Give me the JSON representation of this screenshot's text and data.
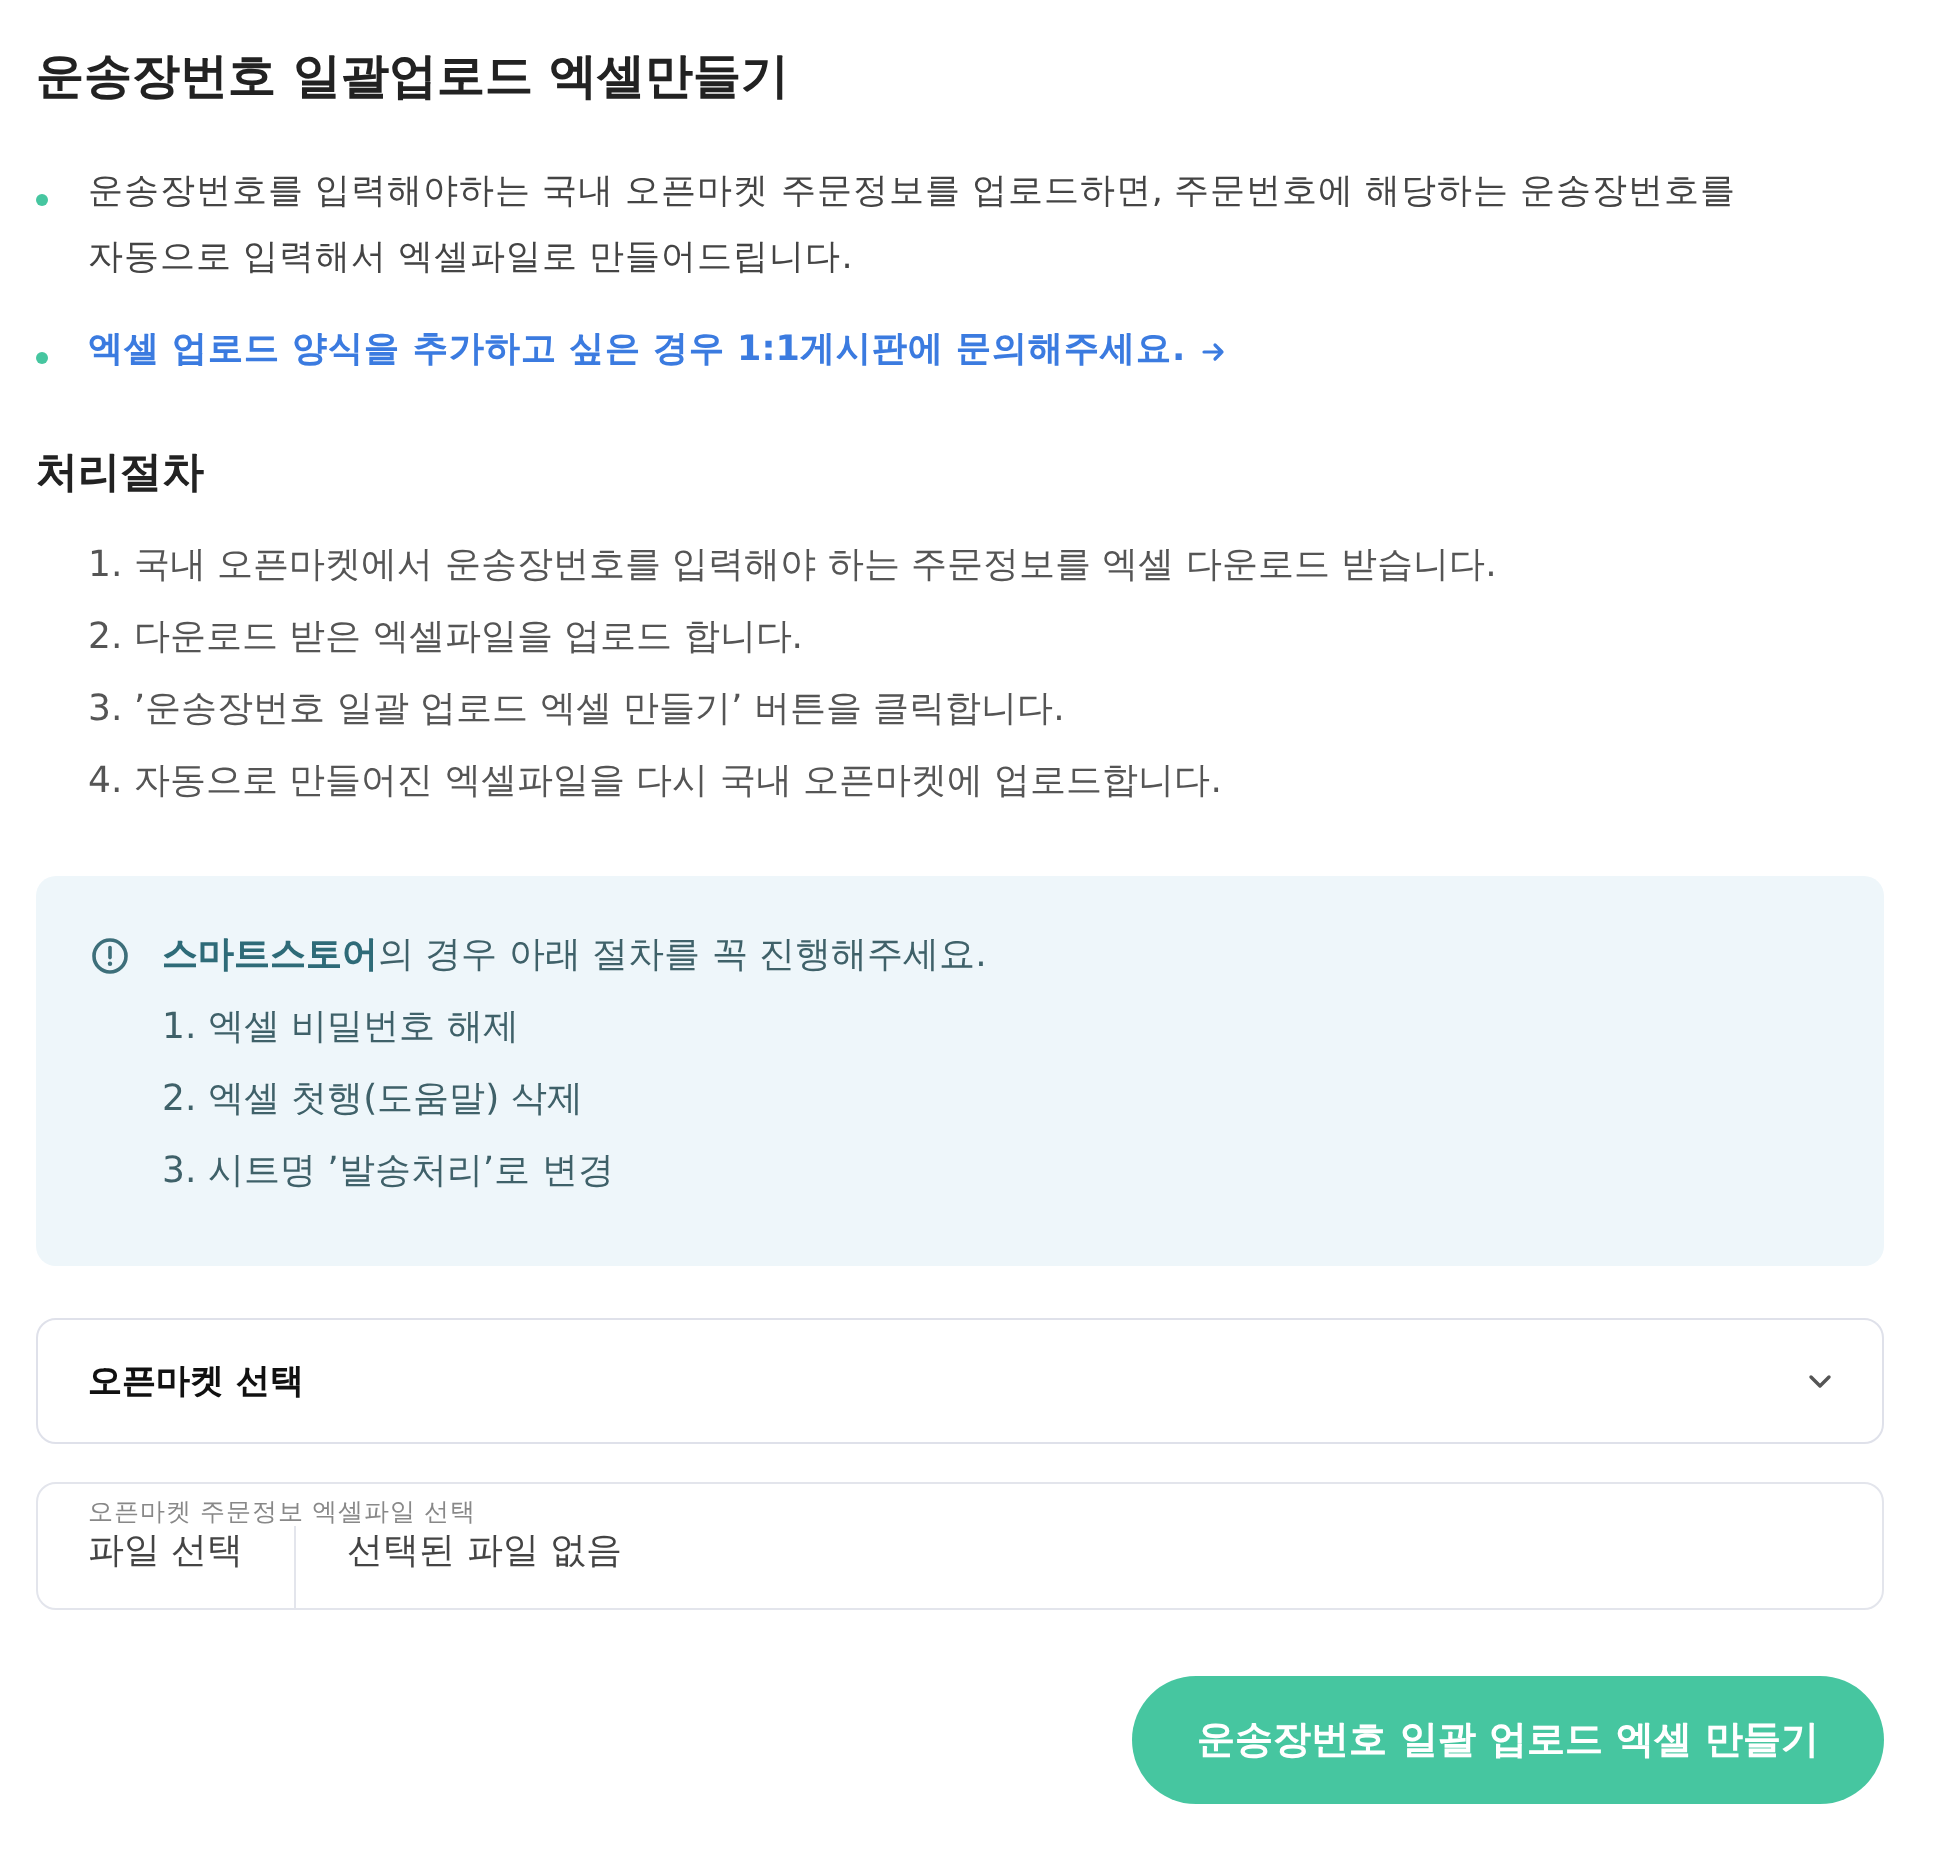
{
  "title": "운송장번호 일괄업로드 엑셀만들기",
  "notes": [
    {
      "kind": "text",
      "text": "운송장번호를 입력해야하는 국내 오픈마켓 주문정보를 업로드하면, 주문번호에 해당하는 운송장번호를 자동으로 입력해서 엑셀파일로 만들어드립니다."
    },
    {
      "kind": "link",
      "text": "엑셀 업로드 양식을 추가하고 싶은 경우 1:1게시판에 문의해주세요."
    }
  ],
  "procedure": {
    "heading": "처리절차",
    "steps": [
      "1. 국내 오픈마켓에서 운송장번호를 입력해야 하는 주문정보를 엑셀 다운로드 받습니다.",
      "2. 다운로드 받은 엑셀파일을 업로드 합니다.",
      "3. ’운송장번호 일괄 업로드 엑셀 만들기’ 버튼을 클릭합니다.",
      "4. 자동으로 만들어진 엑셀파일을 다시 국내 오픈마켓에 업로드합니다."
    ]
  },
  "notice": {
    "text": "**스마트스토어**의 경우 아래 절차를 꼭 진행해주세요.",
    "steps": [
      "1. 엑셀 비밀번호 해제",
      "2. 엑셀 첫행(도움말) 삭제",
      "3. 시트명 ’발송처리’로 변경"
    ]
  },
  "market_select": {
    "value": "오픈마켓 선택"
  },
  "file_field": {
    "label": "오픈마켓 주문정보 엑셀파일 선택",
    "button": "파일 선택",
    "status": "선택된 파일 없음"
  },
  "submit_button": "운송장번호 일괄 업로드 엑셀 만들기"
}
